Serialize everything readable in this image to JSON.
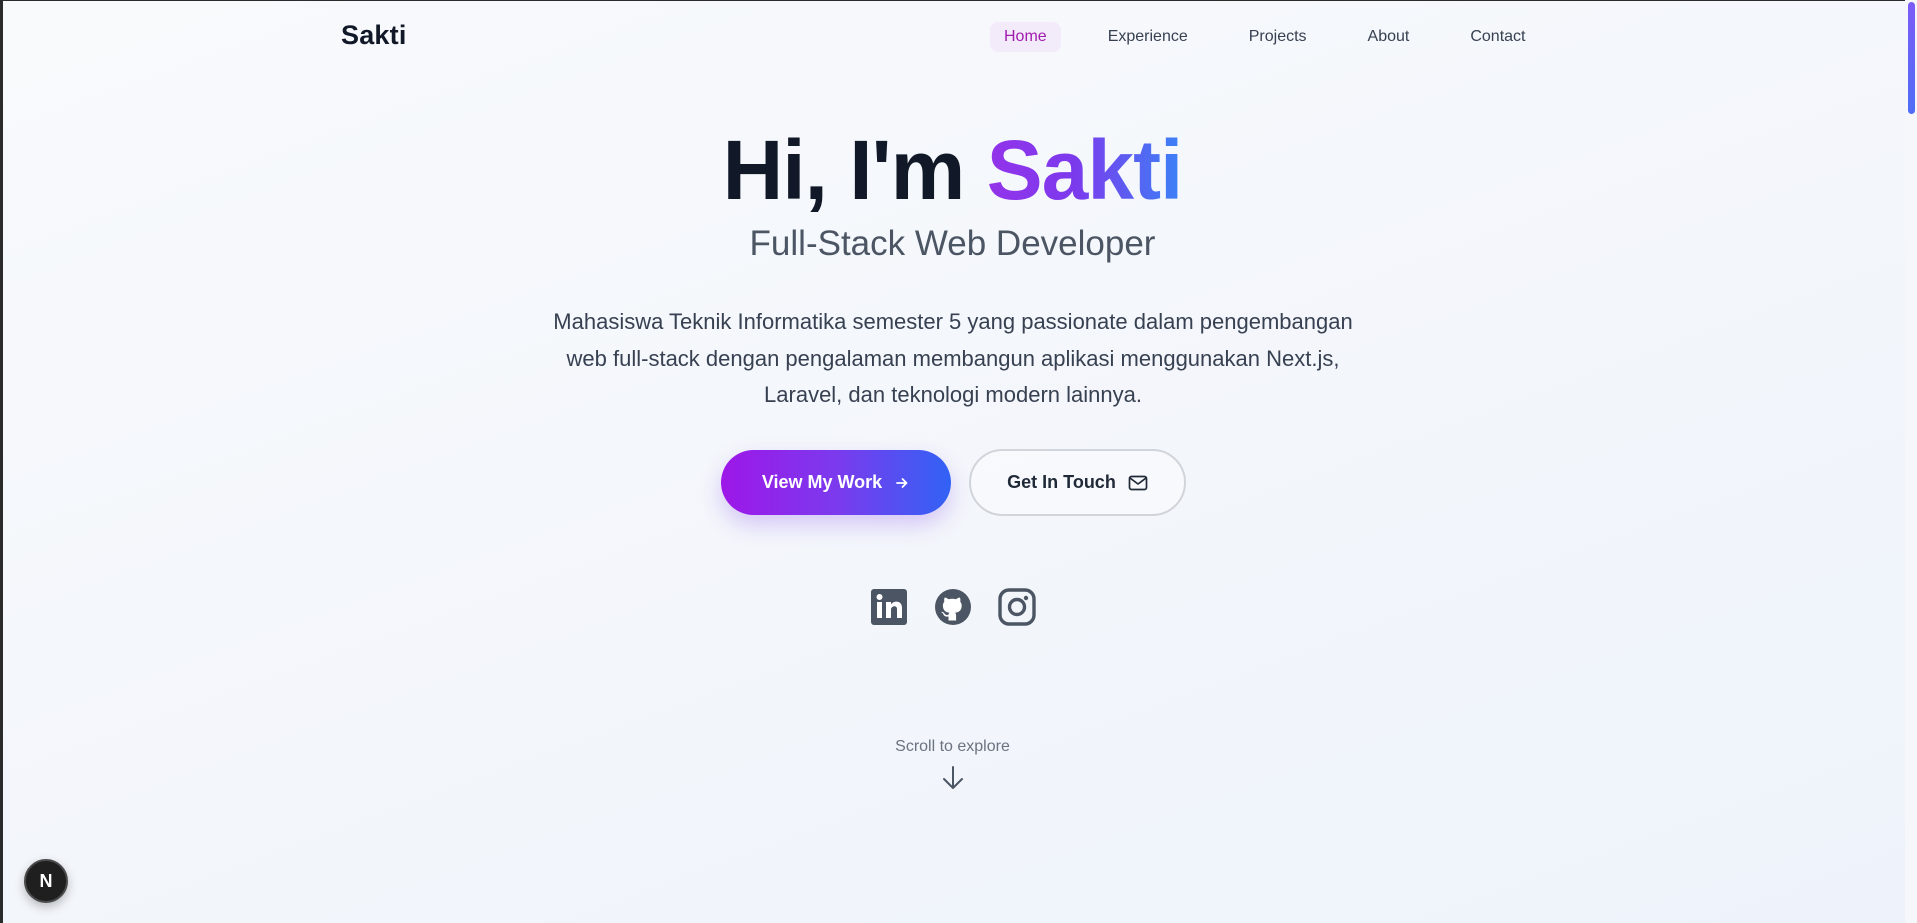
{
  "nav": {
    "brand": "Sakti",
    "links": [
      {
        "label": "Home",
        "active": true
      },
      {
        "label": "Experience",
        "active": false
      },
      {
        "label": "Projects",
        "active": false
      },
      {
        "label": "About",
        "active": false
      },
      {
        "label": "Contact",
        "active": false
      }
    ]
  },
  "hero": {
    "greeting": "Hi, I'm ",
    "name": "Sakti",
    "subtitle": "Full-Stack Web Developer",
    "description": "Mahasiswa Teknik Informatika semester 5 yang passionate dalam pengembangan web full-stack dengan pengalaman membangun aplikasi menggunakan Next.js, Laravel, dan teknologi modern lainnya.",
    "primary_button": "View My Work",
    "secondary_button": "Get In Touch"
  },
  "socials": [
    {
      "icon": "linkedin-icon"
    },
    {
      "icon": "github-icon"
    },
    {
      "icon": "instagram-icon"
    }
  ],
  "scroll_hint": "Scroll to explore",
  "dev_badge": {
    "letter": "N",
    "icon": "nextjs-icon"
  },
  "colors": {
    "accent_purple": "#9333ea",
    "accent_blue": "#3b82f6",
    "active_nav": "#a21caf",
    "text_dark": "#111827",
    "text_muted": "#4b5563"
  }
}
